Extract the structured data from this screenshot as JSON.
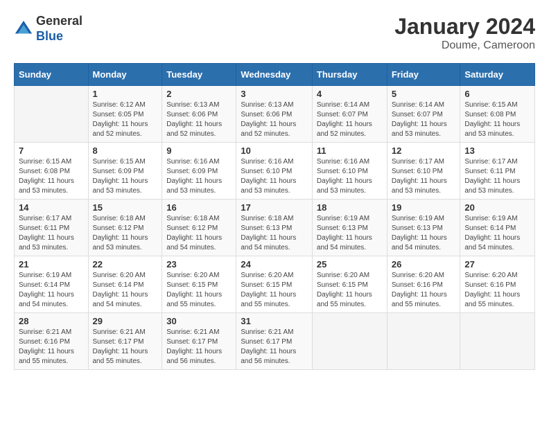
{
  "header": {
    "logo": {
      "line1": "General",
      "line2": "Blue"
    },
    "title": "January 2024",
    "location": "Doume, Cameroon"
  },
  "days_of_week": [
    "Sunday",
    "Monday",
    "Tuesday",
    "Wednesday",
    "Thursday",
    "Friday",
    "Saturday"
  ],
  "weeks": [
    [
      {
        "day": "",
        "sunrise": "",
        "sunset": "",
        "daylight": ""
      },
      {
        "day": "1",
        "sunrise": "Sunrise: 6:12 AM",
        "sunset": "Sunset: 6:05 PM",
        "daylight": "Daylight: 11 hours and 52 minutes."
      },
      {
        "day": "2",
        "sunrise": "Sunrise: 6:13 AM",
        "sunset": "Sunset: 6:06 PM",
        "daylight": "Daylight: 11 hours and 52 minutes."
      },
      {
        "day": "3",
        "sunrise": "Sunrise: 6:13 AM",
        "sunset": "Sunset: 6:06 PM",
        "daylight": "Daylight: 11 hours and 52 minutes."
      },
      {
        "day": "4",
        "sunrise": "Sunrise: 6:14 AM",
        "sunset": "Sunset: 6:07 PM",
        "daylight": "Daylight: 11 hours and 52 minutes."
      },
      {
        "day": "5",
        "sunrise": "Sunrise: 6:14 AM",
        "sunset": "Sunset: 6:07 PM",
        "daylight": "Daylight: 11 hours and 53 minutes."
      },
      {
        "day": "6",
        "sunrise": "Sunrise: 6:15 AM",
        "sunset": "Sunset: 6:08 PM",
        "daylight": "Daylight: 11 hours and 53 minutes."
      }
    ],
    [
      {
        "day": "7",
        "sunrise": "Sunrise: 6:15 AM",
        "sunset": "Sunset: 6:08 PM",
        "daylight": "Daylight: 11 hours and 53 minutes."
      },
      {
        "day": "8",
        "sunrise": "Sunrise: 6:15 AM",
        "sunset": "Sunset: 6:09 PM",
        "daylight": "Daylight: 11 hours and 53 minutes."
      },
      {
        "day": "9",
        "sunrise": "Sunrise: 6:16 AM",
        "sunset": "Sunset: 6:09 PM",
        "daylight": "Daylight: 11 hours and 53 minutes."
      },
      {
        "day": "10",
        "sunrise": "Sunrise: 6:16 AM",
        "sunset": "Sunset: 6:10 PM",
        "daylight": "Daylight: 11 hours and 53 minutes."
      },
      {
        "day": "11",
        "sunrise": "Sunrise: 6:16 AM",
        "sunset": "Sunset: 6:10 PM",
        "daylight": "Daylight: 11 hours and 53 minutes."
      },
      {
        "day": "12",
        "sunrise": "Sunrise: 6:17 AM",
        "sunset": "Sunset: 6:10 PM",
        "daylight": "Daylight: 11 hours and 53 minutes."
      },
      {
        "day": "13",
        "sunrise": "Sunrise: 6:17 AM",
        "sunset": "Sunset: 6:11 PM",
        "daylight": "Daylight: 11 hours and 53 minutes."
      }
    ],
    [
      {
        "day": "14",
        "sunrise": "Sunrise: 6:17 AM",
        "sunset": "Sunset: 6:11 PM",
        "daylight": "Daylight: 11 hours and 53 minutes."
      },
      {
        "day": "15",
        "sunrise": "Sunrise: 6:18 AM",
        "sunset": "Sunset: 6:12 PM",
        "daylight": "Daylight: 11 hours and 53 minutes."
      },
      {
        "day": "16",
        "sunrise": "Sunrise: 6:18 AM",
        "sunset": "Sunset: 6:12 PM",
        "daylight": "Daylight: 11 hours and 54 minutes."
      },
      {
        "day": "17",
        "sunrise": "Sunrise: 6:18 AM",
        "sunset": "Sunset: 6:13 PM",
        "daylight": "Daylight: 11 hours and 54 minutes."
      },
      {
        "day": "18",
        "sunrise": "Sunrise: 6:19 AM",
        "sunset": "Sunset: 6:13 PM",
        "daylight": "Daylight: 11 hours and 54 minutes."
      },
      {
        "day": "19",
        "sunrise": "Sunrise: 6:19 AM",
        "sunset": "Sunset: 6:13 PM",
        "daylight": "Daylight: 11 hours and 54 minutes."
      },
      {
        "day": "20",
        "sunrise": "Sunrise: 6:19 AM",
        "sunset": "Sunset: 6:14 PM",
        "daylight": "Daylight: 11 hours and 54 minutes."
      }
    ],
    [
      {
        "day": "21",
        "sunrise": "Sunrise: 6:19 AM",
        "sunset": "Sunset: 6:14 PM",
        "daylight": "Daylight: 11 hours and 54 minutes."
      },
      {
        "day": "22",
        "sunrise": "Sunrise: 6:20 AM",
        "sunset": "Sunset: 6:14 PM",
        "daylight": "Daylight: 11 hours and 54 minutes."
      },
      {
        "day": "23",
        "sunrise": "Sunrise: 6:20 AM",
        "sunset": "Sunset: 6:15 PM",
        "daylight": "Daylight: 11 hours and 55 minutes."
      },
      {
        "day": "24",
        "sunrise": "Sunrise: 6:20 AM",
        "sunset": "Sunset: 6:15 PM",
        "daylight": "Daylight: 11 hours and 55 minutes."
      },
      {
        "day": "25",
        "sunrise": "Sunrise: 6:20 AM",
        "sunset": "Sunset: 6:15 PM",
        "daylight": "Daylight: 11 hours and 55 minutes."
      },
      {
        "day": "26",
        "sunrise": "Sunrise: 6:20 AM",
        "sunset": "Sunset: 6:16 PM",
        "daylight": "Daylight: 11 hours and 55 minutes."
      },
      {
        "day": "27",
        "sunrise": "Sunrise: 6:20 AM",
        "sunset": "Sunset: 6:16 PM",
        "daylight": "Daylight: 11 hours and 55 minutes."
      }
    ],
    [
      {
        "day": "28",
        "sunrise": "Sunrise: 6:21 AM",
        "sunset": "Sunset: 6:16 PM",
        "daylight": "Daylight: 11 hours and 55 minutes."
      },
      {
        "day": "29",
        "sunrise": "Sunrise: 6:21 AM",
        "sunset": "Sunset: 6:17 PM",
        "daylight": "Daylight: 11 hours and 55 minutes."
      },
      {
        "day": "30",
        "sunrise": "Sunrise: 6:21 AM",
        "sunset": "Sunset: 6:17 PM",
        "daylight": "Daylight: 11 hours and 56 minutes."
      },
      {
        "day": "31",
        "sunrise": "Sunrise: 6:21 AM",
        "sunset": "Sunset: 6:17 PM",
        "daylight": "Daylight: 11 hours and 56 minutes."
      },
      {
        "day": "",
        "sunrise": "",
        "sunset": "",
        "daylight": ""
      },
      {
        "day": "",
        "sunrise": "",
        "sunset": "",
        "daylight": ""
      },
      {
        "day": "",
        "sunrise": "",
        "sunset": "",
        "daylight": ""
      }
    ]
  ]
}
